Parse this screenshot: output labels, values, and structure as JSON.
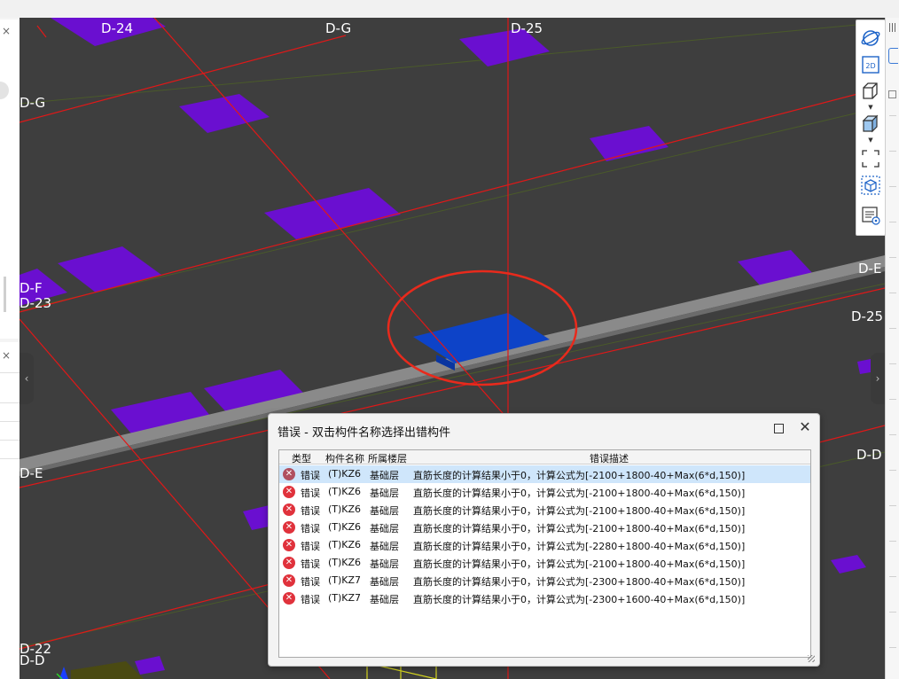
{
  "viewport": {
    "axis_labels": [
      {
        "id": "d24",
        "text": "D-24"
      },
      {
        "id": "dg-top",
        "text": "D-G"
      },
      {
        "id": "d25-top",
        "text": "D-25"
      },
      {
        "id": "dg-left",
        "text": "D-G"
      },
      {
        "id": "df",
        "text": "D-F"
      },
      {
        "id": "d23",
        "text": "D-23"
      },
      {
        "id": "de-right",
        "text": "D-E"
      },
      {
        "id": "d25-right",
        "text": "D-25"
      },
      {
        "id": "de-left",
        "text": "D-E"
      },
      {
        "id": "dd-right",
        "text": "D-D"
      },
      {
        "id": "d22",
        "text": "D-22"
      },
      {
        "id": "dd-left",
        "text": "D-D"
      }
    ]
  },
  "toolbar": {
    "items": [
      "orbit-icon",
      "view-2d-icon",
      "cube-wire-icon",
      "cube-solid-icon",
      "fit-view-icon",
      "select-3d-icon",
      "layer-list-icon"
    ],
    "view_2d_label": "2D"
  },
  "dialog": {
    "title": "错误 - 双击构件名称选择出错构件",
    "columns": [
      "类型",
      "构件名称",
      "所属楼层",
      "错误描述"
    ],
    "rows": [
      {
        "type": "错误",
        "name": "(T)KZ6",
        "floor": "基础层",
        "desc": "直筋长度的计算结果小于0，计算公式为[-2100+1800-40+Max(6*d,150)]",
        "selected": true
      },
      {
        "type": "错误",
        "name": "(T)KZ6",
        "floor": "基础层",
        "desc": "直筋长度的计算结果小于0，计算公式为[-2100+1800-40+Max(6*d,150)]",
        "selected": false
      },
      {
        "type": "错误",
        "name": "(T)KZ6",
        "floor": "基础层",
        "desc": "直筋长度的计算结果小于0，计算公式为[-2100+1800-40+Max(6*d,150)]",
        "selected": false
      },
      {
        "type": "错误",
        "name": "(T)KZ6",
        "floor": "基础层",
        "desc": "直筋长度的计算结果小于0，计算公式为[-2100+1800-40+Max(6*d,150)]",
        "selected": false
      },
      {
        "type": "错误",
        "name": "(T)KZ6",
        "floor": "基础层",
        "desc": "直筋长度的计算结果小于0，计算公式为[-2280+1800-40+Max(6*d,150)]",
        "selected": false
      },
      {
        "type": "错误",
        "name": "(T)KZ6",
        "floor": "基础层",
        "desc": "直筋长度的计算结果小于0，计算公式为[-2100+1800-40+Max(6*d,150)]",
        "selected": false
      },
      {
        "type": "错误",
        "name": "(T)KZ7",
        "floor": "基础层",
        "desc": "直筋长度的计算结果小于0，计算公式为[-2300+1800-40+Max(6*d,150)]",
        "selected": false
      },
      {
        "type": "错误",
        "name": "(T)KZ7",
        "floor": "基础层",
        "desc": "直筋长度的计算结果小于0，计算公式为[-2300+1600-40+Max(6*d,150)]",
        "selected": false
      }
    ]
  },
  "colors": {
    "background": "#3e3e3e",
    "footing": "#6a0fd0",
    "selected_footing": "#0d43c8",
    "grid_line": "#e01818",
    "beam": "#8a8a8a",
    "highlight_circle": "#e82a1c"
  }
}
